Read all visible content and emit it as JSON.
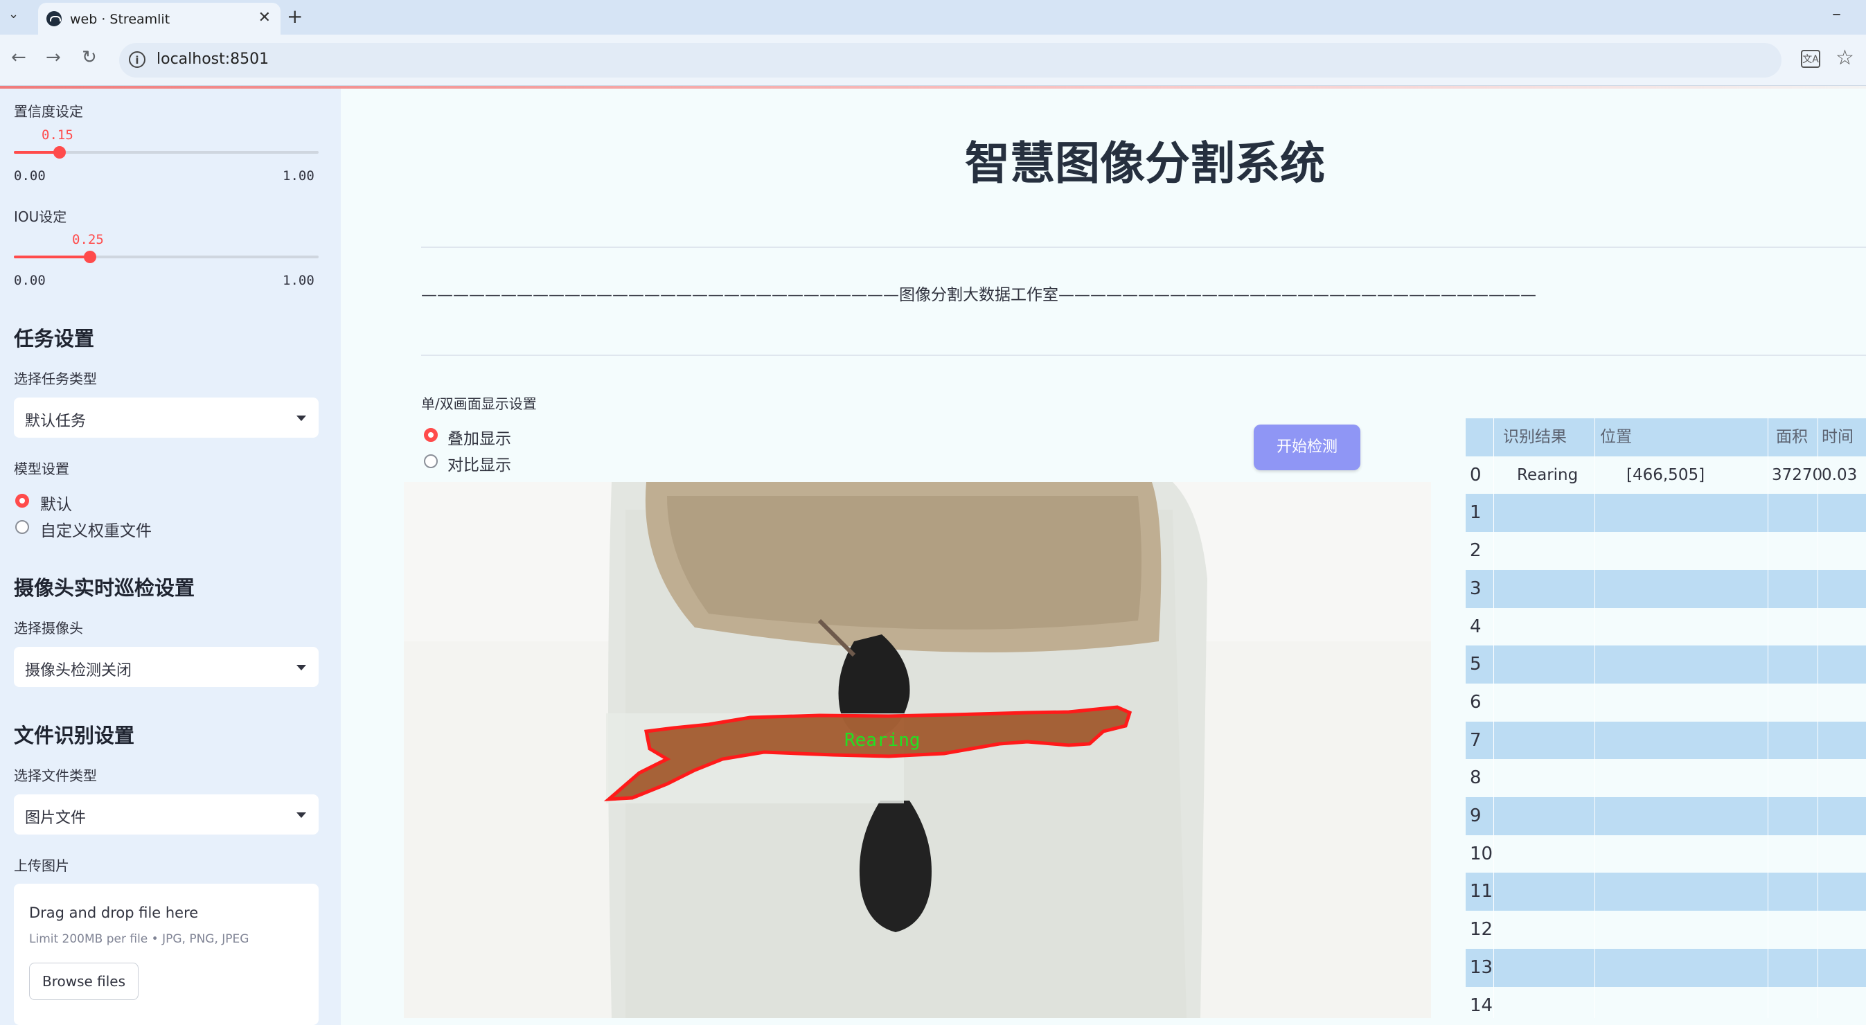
{
  "browser": {
    "tab_title": "web · Streamlit",
    "url": "localhost:8501"
  },
  "sidebar": {
    "confidence": {
      "label": "置信度设定",
      "value": "0.15",
      "min": "0.00",
      "max": "1.00",
      "fraction": 0.15
    },
    "iou": {
      "label": "IOU设定",
      "value": "0.25",
      "min": "0.00",
      "max": "1.00",
      "fraction": 0.25
    },
    "task": {
      "header": "任务设置",
      "select_label": "选择任务类型",
      "selected": "默认任务"
    },
    "model": {
      "label": "模型设置",
      "options": [
        "默认",
        "自定义权重文件"
      ],
      "selected_index": 0
    },
    "camera": {
      "header": "摄像头实时巡检设置",
      "select_label": "选择摄像头",
      "selected": "摄像头检测关闭"
    },
    "file": {
      "header": "文件识别设置",
      "select_label": "选择文件类型",
      "selected": "图片文件"
    },
    "upload": {
      "label": "上传图片",
      "drop_text": "Drag and drop file here",
      "limit_text": "Limit 200MB per file • JPG, PNG, JPEG",
      "browse_label": "Browse files"
    }
  },
  "main": {
    "title": "智慧图像分割系统",
    "banner": "——————————————————————————————图像分割大数据工作室——————————————————————————————",
    "display_label": "单/双画面显示设置",
    "display_options": [
      "叠加显示",
      "对比显示"
    ],
    "display_selected_index": 0,
    "start_button": "开始检测",
    "detection_label": "Rearing"
  },
  "table": {
    "columns": [
      "识别结果",
      "位置",
      "面积",
      "时间"
    ],
    "rows": [
      {
        "index": "0",
        "result": "Rearing",
        "position": "[466,505]",
        "area": "37270",
        "time": "0.03"
      },
      {
        "index": "1"
      },
      {
        "index": "2"
      },
      {
        "index": "3"
      },
      {
        "index": "4"
      },
      {
        "index": "5"
      },
      {
        "index": "6"
      },
      {
        "index": "7"
      },
      {
        "index": "8"
      },
      {
        "index": "9"
      },
      {
        "index": "10"
      },
      {
        "index": "11"
      },
      {
        "index": "12"
      },
      {
        "index": "13"
      },
      {
        "index": "14"
      }
    ]
  },
  "colors": {
    "accent": "#ff4b4b",
    "button": "#8f96f5",
    "row_blue": "#bcdcf3"
  }
}
